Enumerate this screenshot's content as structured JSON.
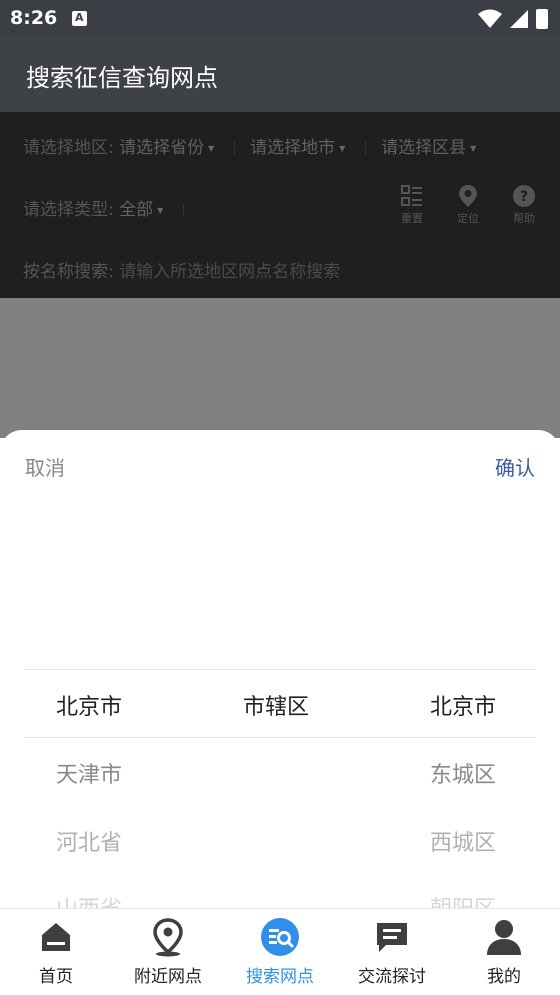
{
  "status_bar": {
    "time": "8:26"
  },
  "app_bar": {
    "title": "搜索征信查询网点"
  },
  "filters": {
    "region_label": "请选择地区:",
    "province": "请选择省份",
    "city": "请选择地市",
    "district": "请选择区县",
    "type_label": "请选择类型:",
    "type_value": "全部",
    "search_label": "按名称搜索:",
    "search_placeholder": "请输入所选地区网点名称搜索",
    "tools": {
      "reset": "重置",
      "locate": "定位",
      "help": "帮助"
    }
  },
  "picker": {
    "cancel": "取消",
    "confirm": "确认",
    "columns": [
      {
        "selected": "北京市",
        "items": [
          "天津市",
          "河北省",
          "山西省"
        ]
      },
      {
        "selected": "市辖区",
        "items": []
      },
      {
        "selected": "北京市",
        "items": [
          "东城区",
          "西城区",
          "朝阳区"
        ]
      }
    ]
  },
  "tabs": [
    {
      "label": "首页",
      "icon": "home-icon"
    },
    {
      "label": "附近网点",
      "icon": "location-pin-icon"
    },
    {
      "label": "搜索网点",
      "icon": "search-list-icon",
      "active": true
    },
    {
      "label": "交流探讨",
      "icon": "chat-icon"
    },
    {
      "label": "我的",
      "icon": "user-icon"
    }
  ],
  "colors": {
    "accent": "#2f8fe9",
    "confirm": "#3a5c9c",
    "app_bar": "#3e4146",
    "panel_dimmed": "#1e1f21"
  }
}
